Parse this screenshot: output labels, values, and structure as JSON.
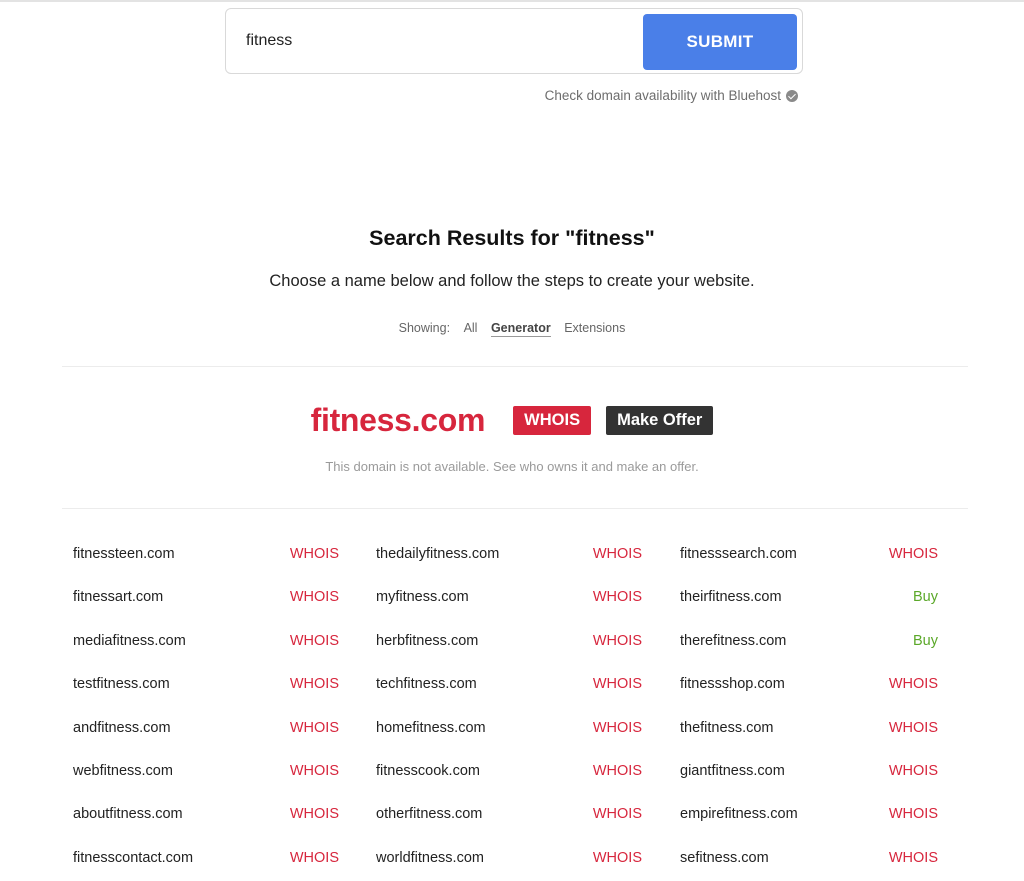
{
  "search": {
    "value": "fitness",
    "submit_label": "SUBMIT",
    "bluehost_note": "Check domain availability with Bluehost"
  },
  "results": {
    "title": "Search Results for \"fitness\"",
    "subtitle": "Choose a name below and follow the steps to create your website.",
    "showing_label": "Showing:",
    "filters": [
      "All",
      "Generator",
      "Extensions"
    ],
    "active_filter": "Generator"
  },
  "featured": {
    "domain": "fitness.com",
    "whois_label": "WHOIS",
    "offer_label": "Make Offer",
    "note": "This domain is not available. See who owns it and make an offer."
  },
  "domains": {
    "col1": [
      {
        "name": "fitnessteen.com",
        "action": "WHOIS"
      },
      {
        "name": "fitnessart.com",
        "action": "WHOIS"
      },
      {
        "name": "mediafitness.com",
        "action": "WHOIS"
      },
      {
        "name": "testfitness.com",
        "action": "WHOIS"
      },
      {
        "name": "andfitness.com",
        "action": "WHOIS"
      },
      {
        "name": "webfitness.com",
        "action": "WHOIS"
      },
      {
        "name": "aboutfitness.com",
        "action": "WHOIS"
      },
      {
        "name": "fitnesscontact.com",
        "action": "WHOIS"
      }
    ],
    "col2": [
      {
        "name": "thedailyfitness.com",
        "action": "WHOIS"
      },
      {
        "name": "myfitness.com",
        "action": "WHOIS"
      },
      {
        "name": "herbfitness.com",
        "action": "WHOIS"
      },
      {
        "name": "techfitness.com",
        "action": "WHOIS"
      },
      {
        "name": "homefitness.com",
        "action": "WHOIS"
      },
      {
        "name": "fitnesscook.com",
        "action": "WHOIS"
      },
      {
        "name": "otherfitness.com",
        "action": "WHOIS"
      },
      {
        "name": "worldfitness.com",
        "action": "WHOIS"
      }
    ],
    "col3": [
      {
        "name": "fitnesssearch.com",
        "action": "WHOIS"
      },
      {
        "name": "theirfitness.com",
        "action": "Buy"
      },
      {
        "name": "therefitness.com",
        "action": "Buy"
      },
      {
        "name": "fitnessshop.com",
        "action": "WHOIS"
      },
      {
        "name": "thefitness.com",
        "action": "WHOIS"
      },
      {
        "name": "giantfitness.com",
        "action": "WHOIS"
      },
      {
        "name": "empirefitness.com",
        "action": "WHOIS"
      },
      {
        "name": "sefitness.com",
        "action": "WHOIS"
      }
    ]
  },
  "colors": {
    "accent_blue": "#4a7fe8",
    "whois_red": "#d7263d",
    "buy_green": "#5ba829",
    "dark_tag": "#333333"
  }
}
